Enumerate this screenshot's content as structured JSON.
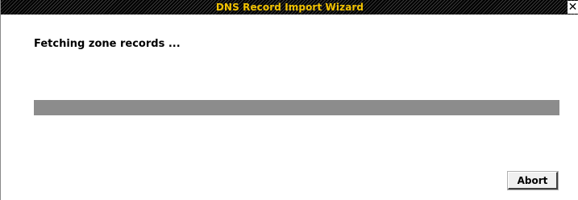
{
  "window": {
    "title": "DNS Record Import Wizard",
    "close_glyph": "✕",
    "title_color": "#f2c200"
  },
  "main": {
    "status_text": "Fetching zone records ...",
    "progress_fraction": 1.0,
    "progress_color": "#8c8c8c"
  },
  "actions": {
    "abort_label": "Abort"
  }
}
